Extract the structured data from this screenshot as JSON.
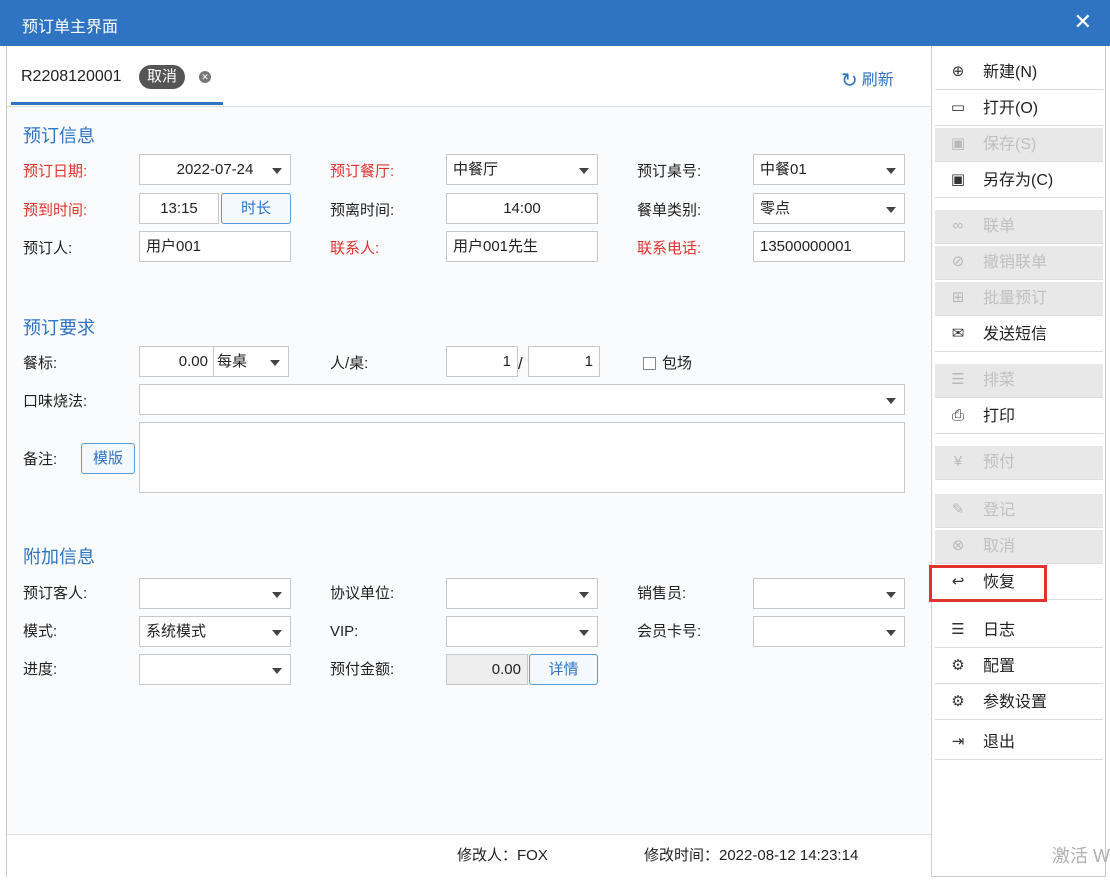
{
  "window": {
    "title": "预订单主界面",
    "close": "✕"
  },
  "tab": {
    "order_no": "R2208120001",
    "status": "取消",
    "close": "✕",
    "refresh": "刷新"
  },
  "sections": {
    "info": "预订信息",
    "req": "预订要求",
    "extra": "附加信息"
  },
  "fields": {
    "date_label": "预订日期:",
    "date": "2022-07-24",
    "hall_label": "预订餐厅:",
    "hall": "中餐厅",
    "table_label": "预订桌号:",
    "table": "中餐01",
    "arrive_label": "预到时间:",
    "arrive": "13:15",
    "duration_btn": "时长",
    "leave_label": "预离时间:",
    "leave": "14:00",
    "menu_type_label": "餐单类别:",
    "menu_type": "零点",
    "booker_label": "预订人:",
    "booker": "用户001",
    "contact_label": "联系人:",
    "contact": "用户001先生",
    "phone_label": "联系电话:",
    "phone": "13500000001",
    "std_label": "餐标:",
    "std": "0.00",
    "std_unit": "每桌",
    "ppt_label": "人/桌:",
    "people": "1",
    "slash": "/",
    "tables": "1",
    "private_label": "包场",
    "taste_label": "口味烧法:",
    "taste": "",
    "note_label": "备注:",
    "template_btn": "模版",
    "guest_label": "预订客人:",
    "guest": "",
    "agreement_label": "协议单位:",
    "agreement": "",
    "sales_label": "销售员:",
    "sales": "",
    "mode_label": "模式:",
    "mode": "系统模式",
    "vip_label": "VIP:",
    "vip": "",
    "card_label": "会员卡号:",
    "card": "",
    "progress_label": "进度:",
    "progress": "",
    "prepay_label": "预付金额:",
    "prepay": "0.00",
    "detail_btn": "详情"
  },
  "footer": {
    "modifier": "修改人：FOX",
    "modtime": "修改时间：2022-08-12 14:23:14"
  },
  "sidebar": [
    {
      "label": "新建(N)",
      "icon": "⊕"
    },
    {
      "label": "打开(O)",
      "icon": "▭"
    },
    {
      "label": "保存(S)",
      "icon": "▣"
    },
    {
      "label": "另存为(C)",
      "icon": "▣"
    },
    {
      "label": "联单",
      "icon": "∞"
    },
    {
      "label": "撤销联单",
      "icon": "⊘"
    },
    {
      "label": "批量预订",
      "icon": "⊞"
    },
    {
      "label": "发送短信",
      "icon": "✉"
    },
    {
      "label": "排菜",
      "icon": "☰"
    },
    {
      "label": "打印",
      "icon": "⎙"
    },
    {
      "label": "预付",
      "icon": "¥"
    },
    {
      "label": "登记",
      "icon": "✎"
    },
    {
      "label": "取消",
      "icon": "⊗"
    },
    {
      "label": "恢复",
      "icon": "↩"
    },
    {
      "label": "日志",
      "icon": "☰"
    },
    {
      "label": "配置",
      "icon": "⚙"
    },
    {
      "label": "参数设置",
      "icon": "⚙"
    },
    {
      "label": "退出",
      "icon": "⇥"
    }
  ],
  "watermark": "激活 W"
}
